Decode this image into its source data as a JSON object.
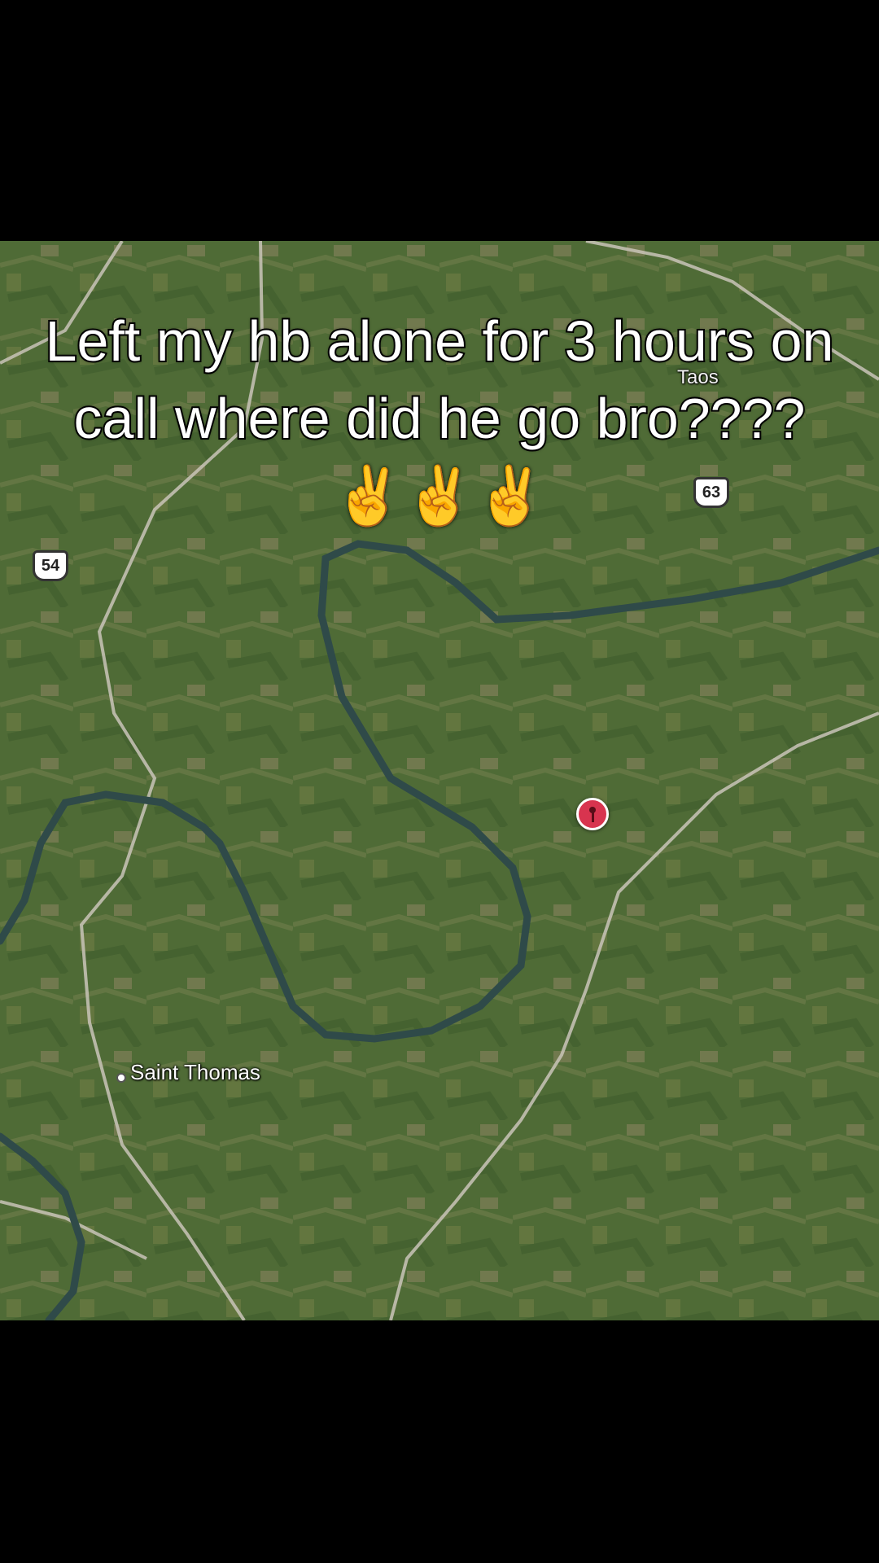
{
  "caption": {
    "text": "Left my hb alone for 3 hours on call where did he go bro???? ✌️✌️✌️"
  },
  "map": {
    "route_shields": [
      "54",
      "63"
    ],
    "place_labels": {
      "saint_thomas": "Saint Thomas",
      "taos": "Taos"
    },
    "pin_icon": "location-pin-icon",
    "colors": {
      "terrain": "#4f6b36",
      "river": "#2f4a49",
      "road": "#c9c4b8",
      "pin": "#d8344f"
    }
  }
}
